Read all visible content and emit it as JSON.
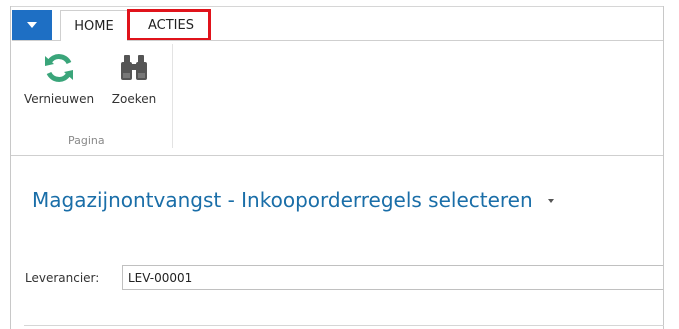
{
  "ribbon": {
    "tabs": [
      {
        "label": "HOME"
      },
      {
        "label": "ACTIES"
      }
    ],
    "buttons": {
      "refresh_label": "Vernieuwen",
      "search_label": "Zoeken"
    },
    "group_label": "Pagina"
  },
  "page": {
    "title": "Magazijnontvangst - Inkooporderregels selecteren"
  },
  "form": {
    "vendor_label": "Leverancier:",
    "vendor_value": "LEV-00001"
  },
  "colors": {
    "accent": "#1e6fc4",
    "title": "#1a6ea8",
    "highlight": "#e0131b",
    "refresh_icon": "#3aa57a",
    "binoculars_icon": "#555555"
  },
  "icons": {
    "app_menu": "triangle-down-icon",
    "refresh": "refresh-icon",
    "search": "binoculars-icon"
  }
}
